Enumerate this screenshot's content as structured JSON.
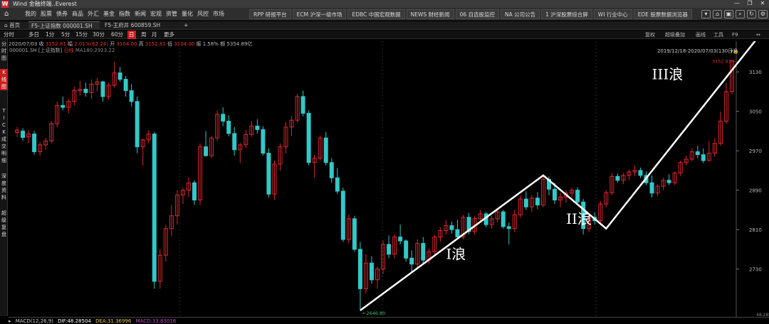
{
  "app": {
    "title": "Wind 金融终端..Everest",
    "logo": "W"
  },
  "window_buttons": [
    "—",
    "❐",
    "✕"
  ],
  "menu": {
    "items": [
      "我的",
      "股票",
      "债券",
      "商品",
      "外汇",
      "基金",
      "指数",
      "新闻",
      "宏观",
      "资管",
      "量化",
      "风控",
      "市场"
    ],
    "func_tabs": [
      "RPP 研报平台",
      "ECM 沪深一级市场",
      "EDBC 中国宏观数据",
      "NEWS 财经新闻",
      "06 自选股监控",
      "NA 公司公告",
      "1 沪深股票综合屏",
      "WI 行业中心",
      "EDE 股票数据浏览器"
    ]
  },
  "doc_tabs": {
    "home": "首页",
    "tabs": [
      "F5-上证指数 000001.SH",
      "F5-王府井 600859.SH"
    ],
    "add": "+"
  },
  "periods": {
    "items": [
      "分时",
      "多日",
      "1分",
      "5分",
      "15分",
      "30分",
      "60分",
      "日",
      "周",
      "月",
      "更多"
    ],
    "active": "日",
    "right_tools": [
      "复权",
      "超级叠加",
      "画线",
      "工具",
      "F9"
    ]
  },
  "quote": {
    "date": "2020/07/03",
    "close_label": "收",
    "close": "3152.81",
    "change_label": "幅",
    "change": "2.01%(62.24)",
    "open_label": "开",
    "open": "3104.00",
    "high_label": "高",
    "high": "3152.81",
    "low_label": "低",
    "low": "3104.00",
    "amp_label": "振",
    "amp": "1.58%",
    "amount_label": "额",
    "amount": "5354.89亿"
  },
  "subheader": {
    "code": "000001.SH",
    "index_name": "[上证指数]",
    "period": "日线",
    "ma": "MA180:2923.22"
  },
  "range": {
    "text": "2019/12/18-2020/07/03(130日)"
  },
  "sidebar": {
    "groups": [
      {
        "label": "分时图",
        "active": false
      },
      {
        "label": "K线图",
        "active": true
      },
      {
        "label": "TICK",
        "active": false
      },
      {
        "label": "成交明细",
        "active": false
      },
      {
        "label": "深度资料",
        "active": false
      },
      {
        "label": "超级复盘",
        "active": false
      }
    ]
  },
  "colors": {
    "up": "#d9272e",
    "down": "#33c8c8",
    "annotation": "#ffffff",
    "active_red": "#c81e1e",
    "low_label": "#39c26a"
  },
  "chart_data": {
    "type": "candlestick",
    "yticks": [
      "3130",
      "3050",
      "2970",
      "2890",
      "2810",
      "2730"
    ],
    "ylim": [
      2640,
      3175
    ],
    "high_marker": "3152.81",
    "low_marker": "2646.80",
    "axis_bottom": "48.28504",
    "grid": false,
    "wave_labels": [
      "I浪",
      "II浪",
      "III浪"
    ],
    "wave_path": [
      {
        "i": 60,
        "y": 2646
      },
      {
        "i": 92,
        "y": 2920
      },
      {
        "i": 103,
        "y": 2812
      },
      {
        "i": 130,
        "y": 3220
      }
    ],
    "wave_label_positions": [
      {
        "i": 75,
        "y": 2750
      },
      {
        "i": 96,
        "y": 2822
      },
      {
        "i": 111,
        "y": 3115
      }
    ],
    "candles": [
      [
        3007,
        3018,
        2998,
        3012
      ],
      [
        3010,
        3016,
        2990,
        2997
      ],
      [
        2998,
        3012,
        2985,
        3004
      ],
      [
        3004,
        3010,
        2962,
        2968
      ],
      [
        2968,
        2988,
        2960,
        2982
      ],
      [
        2982,
        2996,
        2972,
        2990
      ],
      [
        2990,
        3030,
        2985,
        3025
      ],
      [
        3025,
        3070,
        3018,
        3062
      ],
      [
        3062,
        3080,
        3052,
        3058
      ],
      [
        3058,
        3075,
        3046,
        3070
      ],
      [
        3070,
        3100,
        3062,
        3092
      ],
      [
        3092,
        3112,
        3082,
        3095
      ],
      [
        3095,
        3108,
        3080,
        3088
      ],
      [
        3088,
        3115,
        3075,
        3105
      ],
      [
        3105,
        3118,
        3090,
        3110
      ],
      [
        3110,
        3112,
        3070,
        3080
      ],
      [
        3080,
        3108,
        3074,
        3103
      ],
      [
        3103,
        3150,
        3098,
        3128
      ],
      [
        3128,
        3140,
        3110,
        3115
      ],
      [
        3115,
        3122,
        3080,
        3092
      ],
      [
        3092,
        3105,
        3060,
        3070
      ],
      [
        3070,
        3080,
        2965,
        2978
      ],
      [
        2978,
        2995,
        2940,
        2992
      ],
      [
        2992,
        3012,
        2985,
        3004
      ],
      [
        3004,
        3008,
        2690,
        2705
      ],
      [
        2705,
        2770,
        2690,
        2758
      ],
      [
        2758,
        2820,
        2745,
        2812
      ],
      [
        2812,
        2860,
        2796,
        2838
      ],
      [
        2838,
        2890,
        2820,
        2880
      ],
      [
        2880,
        2895,
        2862,
        2890
      ],
      [
        2890,
        2916,
        2876,
        2905
      ],
      [
        2905,
        2910,
        2860,
        2870
      ],
      [
        2870,
        2985,
        2860,
        2978
      ],
      [
        2978,
        3010,
        2958,
        2960
      ],
      [
        2960,
        3000,
        2955,
        2996
      ],
      [
        2996,
        3052,
        2990,
        3044
      ],
      [
        3044,
        3058,
        3020,
        3030
      ],
      [
        3030,
        3042,
        2999,
        3005
      ],
      [
        3005,
        3018,
        2960,
        2972
      ],
      [
        2972,
        2986,
        2945,
        2982
      ],
      [
        2982,
        3012,
        2976,
        3003
      ],
      [
        3003,
        3030,
        2998,
        3020
      ],
      [
        3020,
        3034,
        3005,
        3013
      ],
      [
        3013,
        3020,
        2960,
        2965
      ],
      [
        2965,
        2975,
        2875,
        2882
      ],
      [
        2882,
        2950,
        2870,
        2943
      ],
      [
        2943,
        2985,
        2930,
        2978
      ],
      [
        2978,
        3028,
        2965,
        3018
      ],
      [
        3018,
        3040,
        3000,
        3032
      ],
      [
        3032,
        3086,
        3028,
        3080
      ],
      [
        3080,
        3092,
        3040,
        3046
      ],
      [
        3046,
        3052,
        2940,
        2946
      ],
      [
        2946,
        2962,
        2915,
        2955
      ],
      [
        2955,
        3000,
        2950,
        2996
      ],
      [
        2996,
        3008,
        2940,
        2946
      ],
      [
        2946,
        2955,
        2905,
        2915
      ],
      [
        2915,
        2935,
        2882,
        2888
      ],
      [
        2888,
        2895,
        2785,
        2790
      ],
      [
        2790,
        2840,
        2782,
        2832
      ],
      [
        2832,
        2838,
        2765,
        2770
      ],
      [
        2770,
        2785,
        2646,
        2690
      ],
      [
        2690,
        2760,
        2680,
        2742
      ],
      [
        2742,
        2756,
        2700,
        2708
      ],
      [
        2708,
        2735,
        2690,
        2730
      ],
      [
        2730,
        2788,
        2720,
        2780
      ],
      [
        2780,
        2798,
        2752,
        2760
      ],
      [
        2760,
        2800,
        2752,
        2795
      ],
      [
        2795,
        2820,
        2780,
        2787
      ],
      [
        2787,
        2790,
        2745,
        2752
      ],
      [
        2752,
        2768,
        2725,
        2740
      ],
      [
        2740,
        2790,
        2732,
        2782
      ],
      [
        2782,
        2795,
        2740,
        2748
      ],
      [
        2748,
        2772,
        2740,
        2765
      ],
      [
        2765,
        2800,
        2760,
        2795
      ],
      [
        2795,
        2815,
        2785,
        2808
      ],
      [
        2808,
        2830,
        2800,
        2818
      ],
      [
        2818,
        2826,
        2802,
        2810
      ],
      [
        2810,
        2830,
        2790,
        2795
      ],
      [
        2795,
        2840,
        2790,
        2835
      ],
      [
        2835,
        2844,
        2800,
        2806
      ],
      [
        2806,
        2838,
        2800,
        2832
      ],
      [
        2832,
        2850,
        2826,
        2842
      ],
      [
        2842,
        2846,
        2815,
        2820
      ],
      [
        2820,
        2838,
        2812,
        2832
      ],
      [
        2832,
        2852,
        2825,
        2846
      ],
      [
        2846,
        2850,
        2812,
        2816
      ],
      [
        2816,
        2824,
        2780,
        2812
      ],
      [
        2812,
        2850,
        2805,
        2840
      ],
      [
        2840,
        2880,
        2834,
        2872
      ],
      [
        2872,
        2888,
        2850,
        2856
      ],
      [
        2856,
        2880,
        2846,
        2874
      ],
      [
        2874,
        2886,
        2852,
        2860
      ],
      [
        2860,
        2920,
        2855,
        2912
      ],
      [
        2912,
        2918,
        2880,
        2892
      ],
      [
        2892,
        2905,
        2862,
        2870
      ],
      [
        2870,
        2885,
        2855,
        2876
      ],
      [
        2876,
        2890,
        2864,
        2884
      ],
      [
        2884,
        2895,
        2870,
        2890
      ],
      [
        2890,
        2896,
        2860,
        2866
      ],
      [
        2866,
        2872,
        2800,
        2812
      ],
      [
        2812,
        2840,
        2805,
        2835
      ],
      [
        2835,
        2845,
        2820,
        2828
      ],
      [
        2828,
        2868,
        2822,
        2862
      ],
      [
        2862,
        2890,
        2855,
        2885
      ],
      [
        2885,
        2925,
        2880,
        2918
      ],
      [
        2918,
        2924,
        2905,
        2910
      ],
      [
        2910,
        2925,
        2902,
        2920
      ],
      [
        2920,
        2932,
        2910,
        2927
      ],
      [
        2927,
        2940,
        2918,
        2930
      ],
      [
        2930,
        2936,
        2915,
        2920
      ],
      [
        2920,
        2928,
        2900,
        2905
      ],
      [
        2905,
        2920,
        2875,
        2884
      ],
      [
        2884,
        2902,
        2878,
        2898
      ],
      [
        2898,
        2915,
        2890,
        2910
      ],
      [
        2910,
        2922,
        2900,
        2905
      ],
      [
        2905,
        2928,
        2900,
        2925
      ],
      [
        2925,
        2950,
        2918,
        2946
      ],
      [
        2946,
        2960,
        2940,
        2953
      ],
      [
        2953,
        2975,
        2948,
        2968
      ],
      [
        2968,
        2980,
        2955,
        2962
      ],
      [
        2962,
        2975,
        2945,
        2950
      ],
      [
        2950,
        2990,
        2948,
        2965
      ],
      [
        2965,
        2996,
        2958,
        2985
      ],
      [
        2985,
        3050,
        2980,
        3030
      ],
      [
        3030,
        3108,
        3025,
        3090
      ],
      [
        3090,
        3152.81,
        3085,
        3152.81
      ]
    ]
  },
  "macd": {
    "label": "MACD(12,26,9)",
    "dif": "DIF:48.28504",
    "dea": "DEA:31.36996",
    "macd": "MACD:33.83016",
    "colors": {
      "label": "#cccccc",
      "dif": "#ffffff",
      "dea": "#e6c84a",
      "macd": "#c84ad0"
    }
  }
}
